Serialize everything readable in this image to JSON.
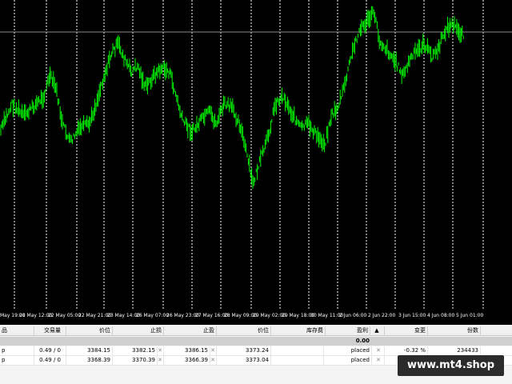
{
  "chart": {
    "background": "#000000",
    "candle_color": "#00ff00",
    "separator_color": "#ffffff",
    "bid_line_color": "#8c8c8c",
    "time_labels": [
      "May 19:00",
      "21 May 12:00",
      "22 May 05:00",
      "22 May 21:00",
      "23 May 14:00",
      "26 May 07:00",
      "26 May 23:00",
      "27 May 16:00",
      "28 May 09:00",
      "29 May 02:00",
      "29 May 18:00",
      "30 May 11:00",
      "2 Jun 06:00",
      "2 Jun 22:00",
      "3 Jun 15:00",
      "4 Jun 08:00",
      "5 Jun 01:00"
    ]
  },
  "terminal": {
    "headers": {
      "symbol": "品",
      "volume": "交易量",
      "price": "价位",
      "sl": "止损",
      "tp": "止盈",
      "price2": "价位",
      "swap": "库存费",
      "profit": "盈利",
      "sort_icon": "▲",
      "change": "变更",
      "ticket": "份数"
    },
    "summary_profit": "0.00",
    "rows": [
      {
        "symbol": "p",
        "volume": "0.49 / 0",
        "price": "3384.15",
        "sl": "3382.15",
        "tp": "3386.15",
        "price2": "3373.24",
        "status": "placed",
        "change": "-0.32 %",
        "ticket": "234433"
      },
      {
        "symbol": "p",
        "volume": "0.49 / 0",
        "price": "3368.39",
        "sl": "3370.39",
        "tp": "3366.39",
        "price2": "3373.04",
        "status": "placed",
        "change": "",
        "ticket": ""
      }
    ],
    "close_glyph": "✕"
  },
  "watermark": "www.mt4.shop"
}
